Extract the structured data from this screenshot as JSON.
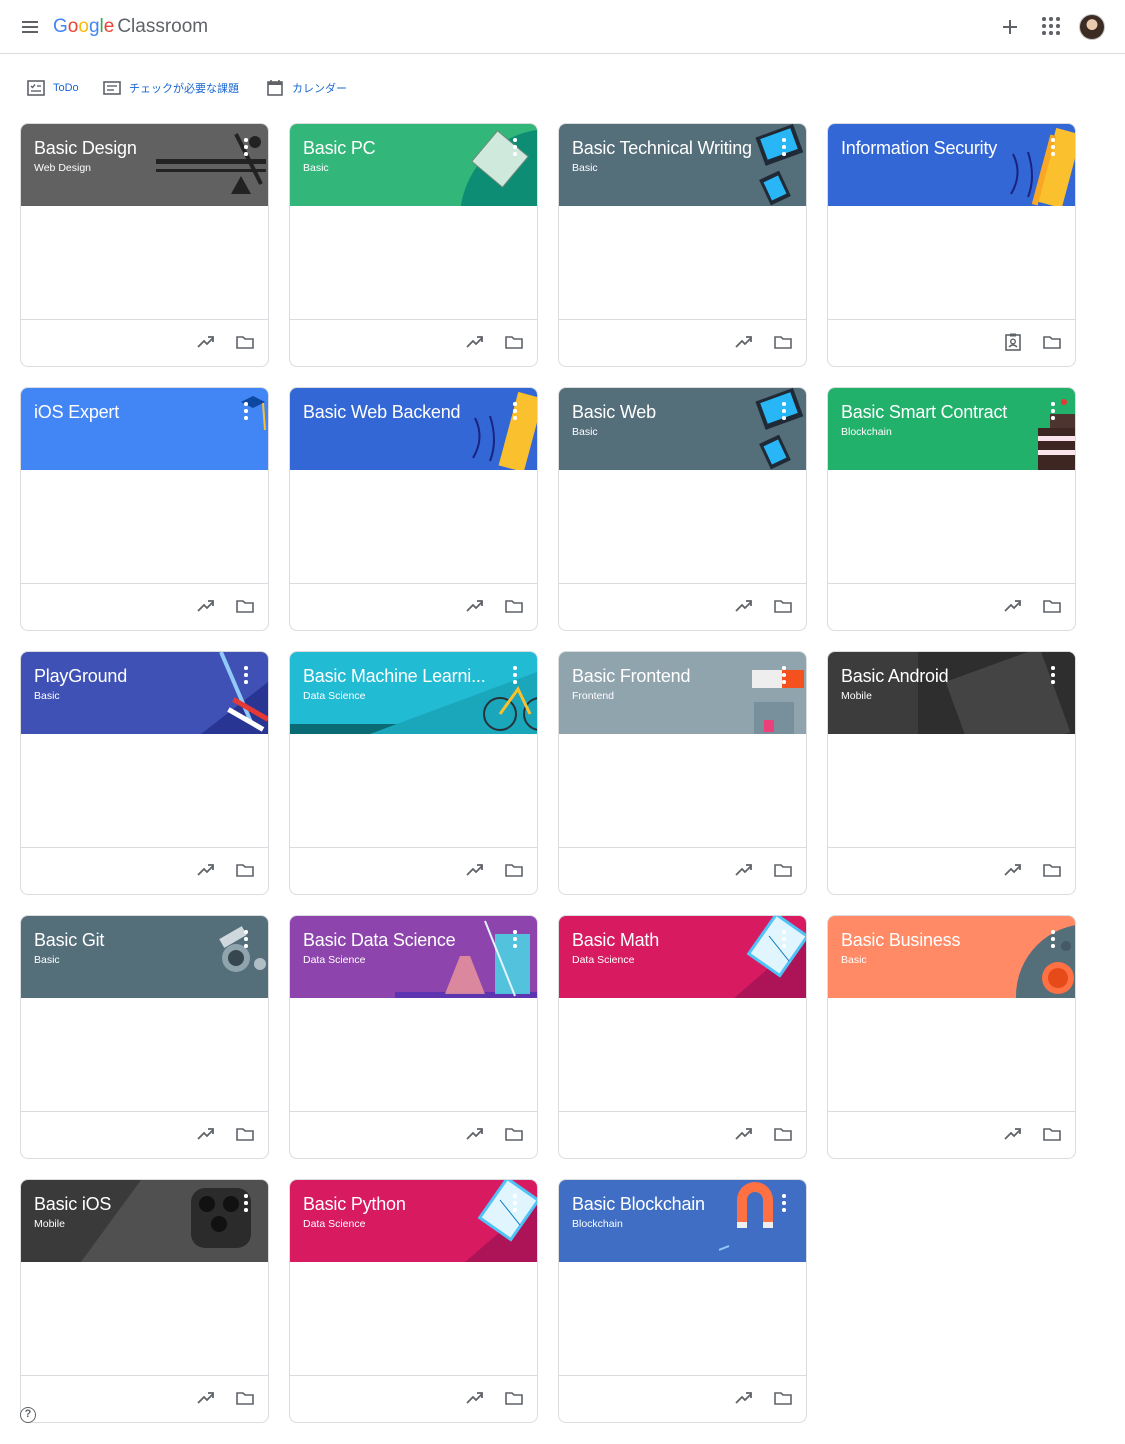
{
  "header": {
    "logo_google": [
      "G",
      "o",
      "o",
      "g",
      "l",
      "e"
    ],
    "logo_product": "Classroom"
  },
  "subnav": {
    "todo": "ToDo",
    "review": "チェックが必要な課題",
    "calendar": "カレンダー"
  },
  "help_label": "?",
  "classes": [
    {
      "title": "Basic Design",
      "section": "Web Design",
      "color": "#616161",
      "footer_left_icon": "trending-up-icon"
    },
    {
      "title": "Basic PC",
      "section": "Basic",
      "color": "#33b679",
      "footer_left_icon": "trending-up-icon"
    },
    {
      "title": "Basic Technical Writing",
      "section": "Basic",
      "color": "#546e7a",
      "footer_left_icon": "trending-up-icon"
    },
    {
      "title": "Information Security",
      "section": "",
      "color": "#3367d6",
      "footer_left_icon": "assignment-ind-icon"
    },
    {
      "title": "iOS Expert",
      "section": "",
      "color": "#4285f4",
      "footer_left_icon": "trending-up-icon"
    },
    {
      "title": "Basic Web Backend",
      "section": "",
      "color": "#3367d6",
      "footer_left_icon": "trending-up-icon"
    },
    {
      "title": "Basic Web",
      "section": "Basic",
      "color": "#546e7a",
      "footer_left_icon": "trending-up-icon"
    },
    {
      "title": "Basic Smart Contract",
      "section": "Blockchain",
      "color": "#21b16a",
      "footer_left_icon": "trending-up-icon"
    },
    {
      "title": "PlayGround",
      "section": "Basic",
      "color": "#3f51b5",
      "footer_left_icon": "trending-up-icon"
    },
    {
      "title": "Basic Machine Learni...",
      "section": "Data Science",
      "color": "#22bbd4",
      "footer_left_icon": "trending-up-icon"
    },
    {
      "title": "Basic Frontend",
      "section": "Frontend",
      "color": "#90a4ae",
      "footer_left_icon": "trending-up-icon"
    },
    {
      "title": "Basic Android",
      "section": "Mobile",
      "color": "#3c3c3c",
      "footer_left_icon": "trending-up-icon"
    },
    {
      "title": "Basic Git",
      "section": "Basic",
      "color": "#546e7a",
      "footer_left_icon": "trending-up-icon"
    },
    {
      "title": "Basic Data Science",
      "section": "Data Science",
      "color": "#8e44ad",
      "footer_left_icon": "trending-up-icon"
    },
    {
      "title": "Basic Math",
      "section": "Data Science",
      "color": "#d81b60",
      "footer_left_icon": "trending-up-icon"
    },
    {
      "title": "Basic Business",
      "section": "Basic",
      "color": "#ff8a65",
      "footer_left_icon": "trending-up-icon"
    },
    {
      "title": "Basic iOS",
      "section": "Mobile",
      "color": "#3a3a3a",
      "footer_left_icon": "trending-up-icon"
    },
    {
      "title": "Basic Python",
      "section": "Data Science",
      "color": "#d81b60",
      "footer_left_icon": "trending-up-icon"
    },
    {
      "title": "Basic Blockchain",
      "section": "Blockchain",
      "color": "#3f6ec4",
      "footer_left_icon": "trending-up-icon"
    }
  ]
}
